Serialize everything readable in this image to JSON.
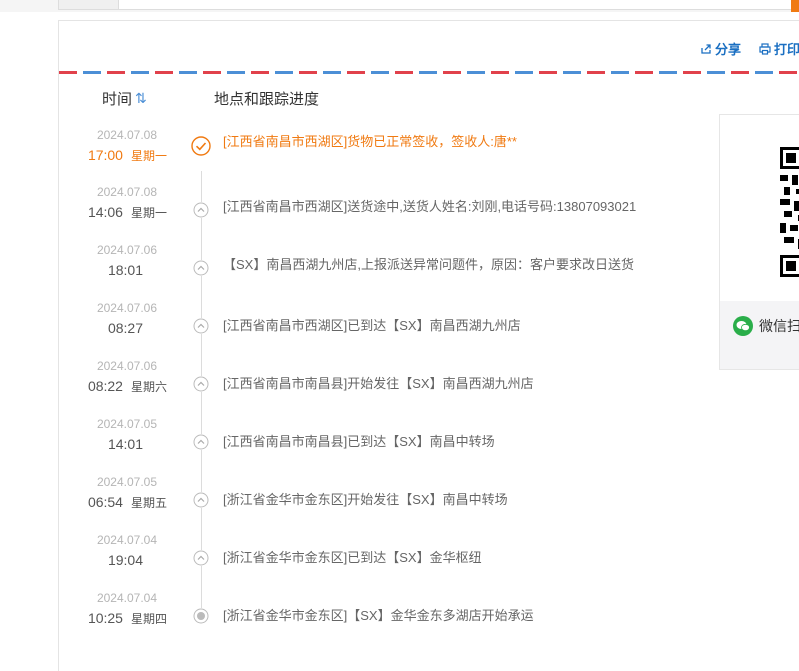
{
  "toolbar": {
    "share_label": "分享",
    "print_label": "打印"
  },
  "table": {
    "col_time": "时间",
    "col_location": "地点和跟踪进度",
    "sort_glyph": "⇅"
  },
  "events": [
    {
      "date": "2024.07.08",
      "time": "17:00",
      "weekday": "星期一",
      "status": "signed",
      "text": "[江西省南昌市西湖区]货物已正常签收，签收人:唐**"
    },
    {
      "date": "2024.07.08",
      "time": "14:06",
      "weekday": "星期一",
      "status": "transit",
      "text": "[江西省南昌市西湖区]送货途中,送货人姓名:刘刚,电话号码:13807093021"
    },
    {
      "date": "2024.07.06",
      "time": "18:01",
      "weekday": "",
      "status": "transit",
      "text": "【SX】南昌西湖九州店,上报派送异常问题件，原因：客户要求改日送货"
    },
    {
      "date": "2024.07.06",
      "time": "08:27",
      "weekday": "",
      "status": "transit",
      "text": "[江西省南昌市西湖区]已到达【SX】南昌西湖九州店"
    },
    {
      "date": "2024.07.06",
      "time": "08:22",
      "weekday": "星期六",
      "status": "transit",
      "text": "[江西省南昌市南昌县]开始发往【SX】南昌西湖九州店"
    },
    {
      "date": "2024.07.05",
      "time": "14:01",
      "weekday": "",
      "status": "transit",
      "text": "[江西省南昌市南昌县]已到达【SX】南昌中转场"
    },
    {
      "date": "2024.07.05",
      "time": "06:54",
      "weekday": "星期五",
      "status": "transit",
      "text": "[浙江省金华市金东区]开始发往【SX】南昌中转场"
    },
    {
      "date": "2024.07.04",
      "time": "19:04",
      "weekday": "",
      "status": "transit",
      "text": "[浙江省金华市金东区]已到达【SX】金华枢纽"
    },
    {
      "date": "2024.07.04",
      "time": "10:25",
      "weekday": "星期四",
      "status": "origin",
      "text": "[浙江省金华市金东区]【SX】金华金东多湖店开始承运"
    }
  ],
  "qr_card": {
    "wechat_label": "微信扫"
  },
  "colors": {
    "accent": "#f07a12",
    "link": "#1a6fc2",
    "wechat": "#2aae4a"
  }
}
